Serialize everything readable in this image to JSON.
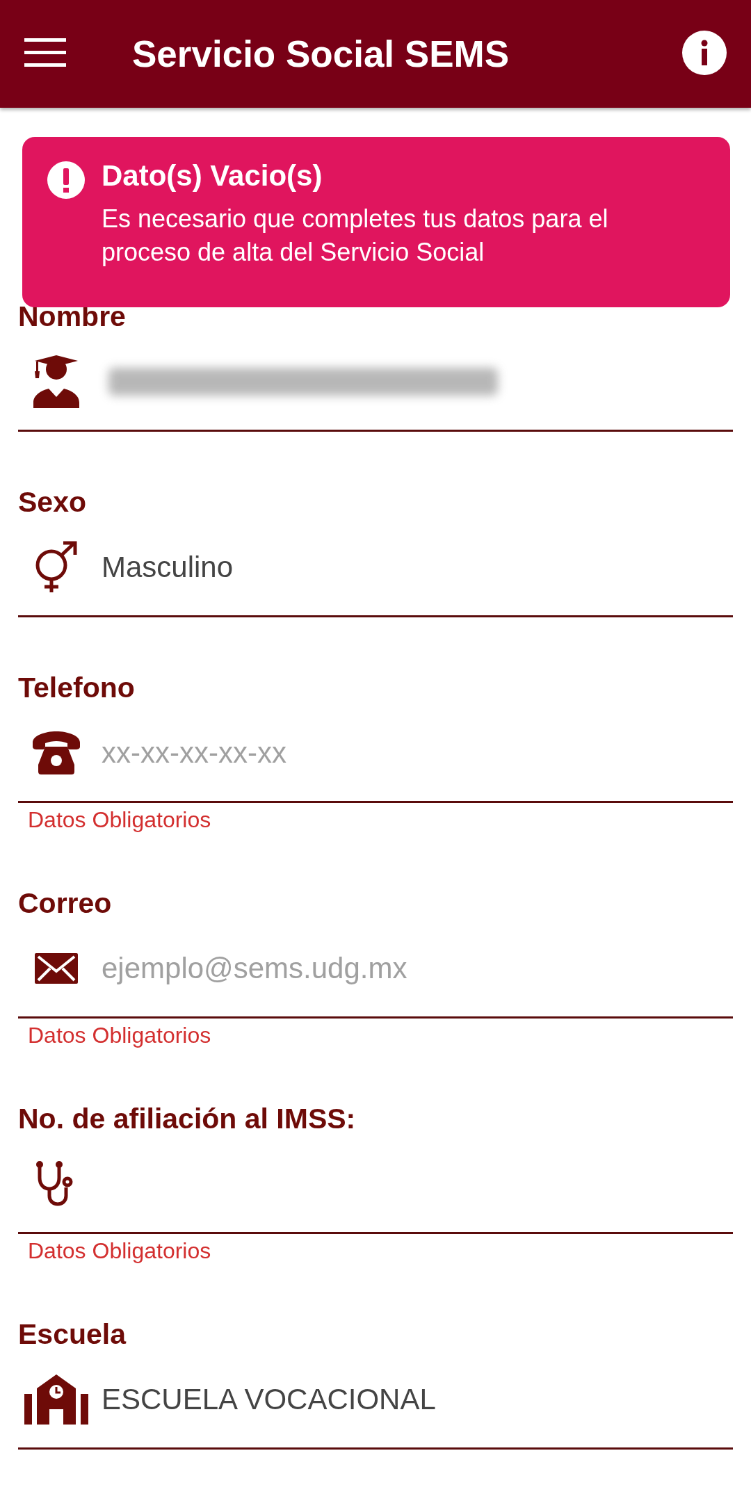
{
  "app_bar": {
    "title": "Servicio Social SEMS"
  },
  "toast": {
    "title": "Dato(s) Vacio(s)",
    "message": "Es necesario que completes tus datos para el proceso de alta del Servicio Social"
  },
  "fields": [
    {
      "label": "Nombre",
      "redacted": true
    },
    {
      "label": "Sexo",
      "value": "Masculino"
    },
    {
      "label": "Telefono",
      "placeholder": "xx-xx-xx-xx-xx",
      "error": "Datos Obligatorios"
    },
    {
      "label": "Correo",
      "placeholder": "ejemplo@sems.udg.mx",
      "error": "Datos Obligatorios"
    },
    {
      "label": "No. de afiliación al IMSS:",
      "error": "Datos Obligatorios"
    },
    {
      "label": "Escuela",
      "value": "ESCUELA VOCACIONAL"
    }
  ]
}
